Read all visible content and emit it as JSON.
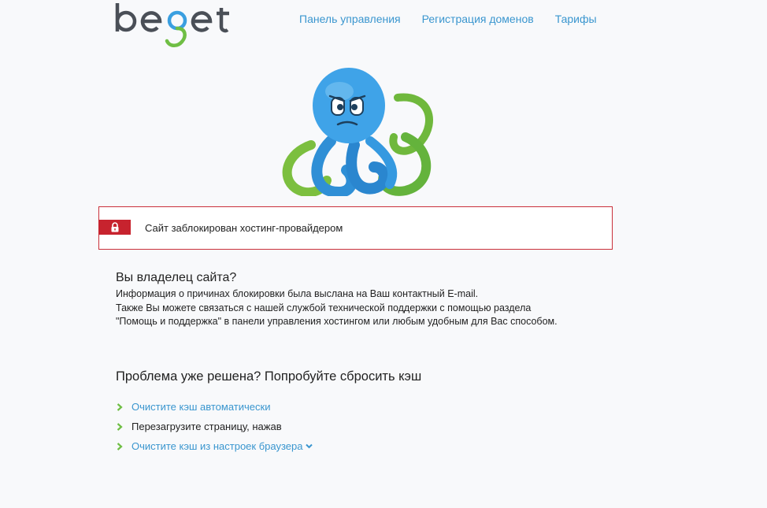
{
  "header": {
    "logo": "beget",
    "nav": [
      {
        "label": "Панель управления"
      },
      {
        "label": "Регистрация доменов"
      },
      {
        "label": "Тарифы"
      }
    ]
  },
  "alert": {
    "text": "Сайт заблокирован хостинг-провайдером",
    "icon": "lock-icon",
    "color": "#c7232e"
  },
  "owner": {
    "title": "Вы владелец сайта?",
    "lines": [
      "Информация о причинах блокировки была выслана на Ваш контактный E-mail.",
      "Также Вы можете связаться с нашей службой технической поддержки с помощью раздела",
      "\"Помощь и поддержка\" в панели управления хостингом или любым удобным для Вас способом."
    ]
  },
  "cache": {
    "title": "Проблема уже решена? Попробуйте сбросить кэш",
    "items": [
      {
        "label": "Очистите кэш автоматически"
      },
      {
        "label": "Перезагрузите страницу, нажав"
      },
      {
        "label": "Очистите кэш из настроек браузера"
      }
    ]
  },
  "colors": {
    "link": "#3a96cf",
    "accent_green": "#6fbe44",
    "alert_red": "#c7232e",
    "octopus_blue": "#3a9fe0"
  }
}
